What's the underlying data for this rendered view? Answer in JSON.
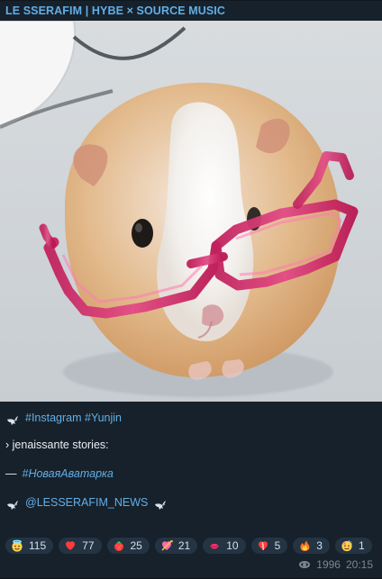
{
  "post": {
    "channel_title": "LE SSERAFIM | HYBE × SOURCE MUSIC",
    "caption": {
      "tags": "#Instagram #Yunjin",
      "stories_line": "› jenaissante stories:",
      "avatar_prefix": "—",
      "avatar_tag": "#НоваяАватарка",
      "news_handle": "@LESSERAFIM_NEWS"
    },
    "reactions": [
      {
        "icon": "angel-emoji-icon",
        "count": "115"
      },
      {
        "icon": "heart-emoji-icon",
        "count": "77"
      },
      {
        "icon": "strawberry-emoji-icon",
        "count": "25"
      },
      {
        "icon": "heart-arrow-emoji-icon",
        "count": "21"
      },
      {
        "icon": "kiss-emoji-icon",
        "count": "10"
      },
      {
        "icon": "broken-heart-emoji-icon",
        "count": "5"
      },
      {
        "icon": "fire-emoji-icon",
        "count": "3"
      },
      {
        "icon": "party-face-emoji-icon",
        "count": "1"
      }
    ],
    "views": "1996",
    "time": "20:15"
  },
  "colors": {
    "background": "#17212b",
    "link": "#62aee6",
    "muted": "#7a8794",
    "chip_bg": "#243443"
  }
}
